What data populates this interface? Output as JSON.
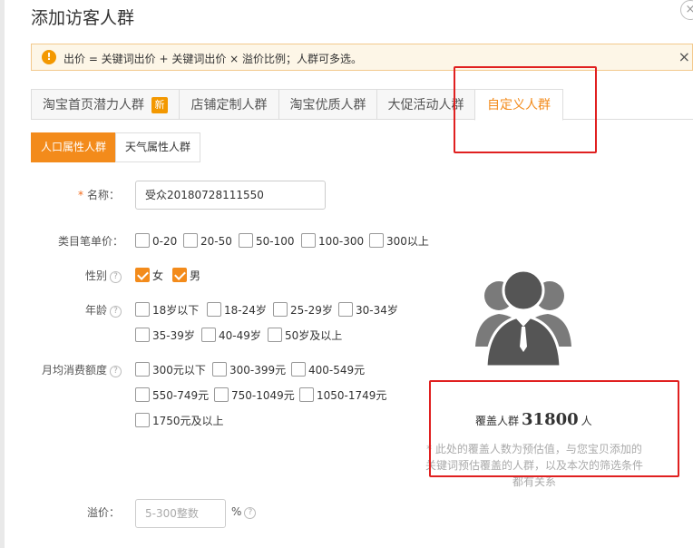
{
  "dialog": {
    "title": "添加访客人群",
    "close_icon": "close-icon"
  },
  "notice": {
    "icon": "!",
    "text": "出价 = 关键词出价 + 关键词出价 × 溢价比例；人群可多选。",
    "close": "×"
  },
  "tabs": [
    {
      "label": "淘宝首页潜力人群",
      "badge": "新"
    },
    {
      "label": "店铺定制人群"
    },
    {
      "label": "淘宝优质人群"
    },
    {
      "label": "大促活动人群"
    },
    {
      "label": "自定义人群",
      "active": true
    }
  ],
  "subtabs": [
    {
      "label": "人口属性人群",
      "active": true
    },
    {
      "label": "天气属性人群"
    }
  ],
  "form": {
    "name": {
      "label": "名称：",
      "required": "*",
      "value": "受众20180728111550"
    },
    "price_category": {
      "label": "类目笔单价：",
      "options": [
        "0-20",
        "20-50",
        "50-100",
        "100-300",
        "300以上"
      ]
    },
    "gender": {
      "label": "性别",
      "options": [
        {
          "label": "女",
          "checked": true
        },
        {
          "label": "男",
          "checked": true
        }
      ]
    },
    "age": {
      "label": "年龄",
      "options": [
        "18岁以下",
        "18-24岁",
        "25-29岁",
        "30-34岁",
        "35-39岁",
        "40-49岁",
        "50岁及以上"
      ]
    },
    "spending": {
      "label": "月均消费额度",
      "options": [
        "300元以下",
        "300-399元",
        "400-549元",
        "550-749元",
        "750-1049元",
        "1050-1749元",
        "1750元及以上"
      ]
    },
    "premium": {
      "label": "溢价：",
      "placeholder": "5-300整数",
      "unit": "%"
    }
  },
  "coverage": {
    "prefix": "覆盖人群",
    "value": "31800",
    "suffix": "人",
    "note": "* 此处的覆盖人数为预估值，与您宝贝添加的关键词预估覆盖的人群，以及本次的筛选条件都有关系"
  },
  "colors": {
    "accent": "#f38b1b",
    "annotation": "#e02020",
    "notice_bg": "#fdf6e7"
  }
}
